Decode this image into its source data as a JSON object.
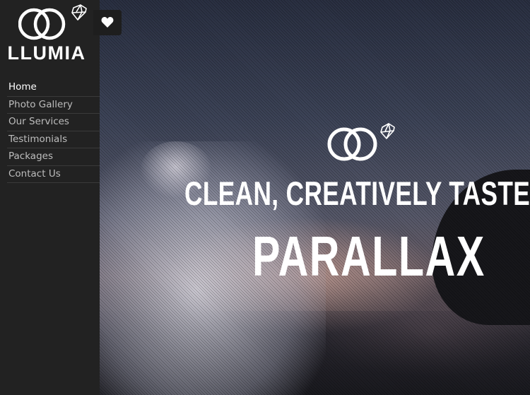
{
  "brand": {
    "name": "LLUMIA"
  },
  "nav": {
    "items": [
      {
        "label": "Home",
        "active": true
      },
      {
        "label": "Photo Gallery"
      },
      {
        "label": "Our Services"
      },
      {
        "label": "Testimonials"
      },
      {
        "label": "Packages"
      },
      {
        "label": "Contact Us"
      }
    ]
  },
  "favorites": {
    "icon": "heart-icon"
  },
  "hero": {
    "tagline": "CLEAN, CREATIVELY TASTEFUL",
    "headline": "PARALLAX",
    "logo_icon": "rings-diamond-icon"
  },
  "colors": {
    "sidebar": "#222222",
    "text_primary": "#ffffff",
    "nav_text": "#bdbdbd"
  }
}
